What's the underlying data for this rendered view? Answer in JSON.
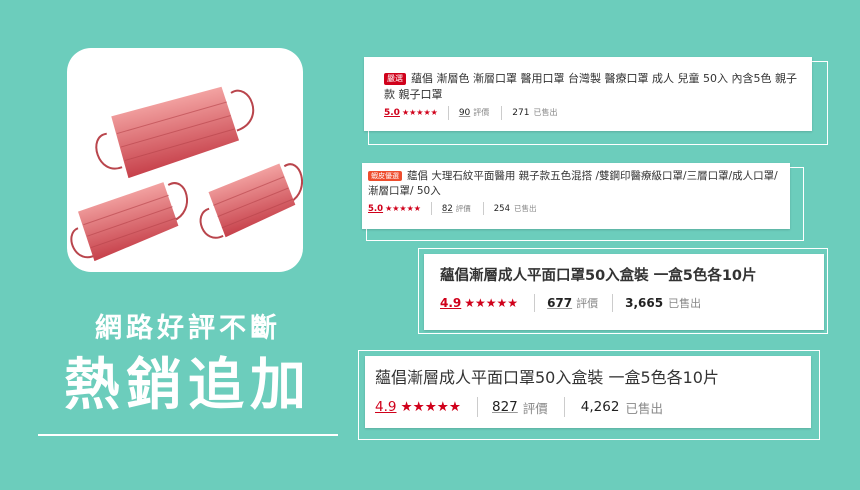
{
  "headline": {
    "small": "網路好評不斷",
    "big": "熱銷追加"
  },
  "colors": {
    "background": "#6ccdbc",
    "accent_red": "#d0011b",
    "mask_pink": "#e88a8c",
    "mask_dark": "#c94a52"
  },
  "listings": [
    {
      "badge": "嚴選",
      "title": "蘊倡 漸層色 漸層口罩 醫用口罩 台灣製 醫療口罩 成人 兒童 50入 內含5色 親子款 親子口罩",
      "rating": "5.0",
      "stars": "★★★★★",
      "reviews": "90",
      "reviews_label": "評價",
      "sold": "271",
      "sold_label": "已售出"
    },
    {
      "badge": "蝦皮優選",
      "title": "蘊倡 大理石紋平面醫用 親子款五色混搭 /雙鋼印醫療級口罩/三層口罩/成人口罩/漸層口罩/ 50入",
      "rating": "5.0",
      "stars": "★★★★★",
      "reviews": "82",
      "reviews_label": "評價",
      "sold": "254",
      "sold_label": "已售出"
    },
    {
      "title": "蘊倡漸層成人平面口罩50入盒裝 一盒5色各10片",
      "rating": "4.9",
      "stars": "★★★★★",
      "reviews": "677",
      "reviews_label": "評價",
      "sold": "3,665",
      "sold_label": "已售出"
    },
    {
      "title": "蘊倡漸層成人平面口罩50入盒裝 一盒5色各10片",
      "rating": "4.9",
      "stars": "★★★★★",
      "reviews": "827",
      "reviews_label": "評價",
      "sold": "4,262",
      "sold_label": "已售出"
    }
  ]
}
